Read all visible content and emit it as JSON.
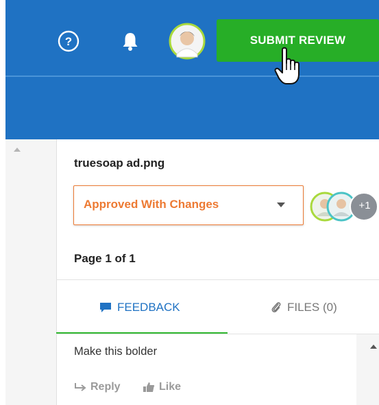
{
  "header": {
    "submit_label": "SUBMIT REVIEW",
    "help_icon": "help-circle-icon",
    "bell_icon": "bell-icon"
  },
  "file": {
    "name": "truesoap ad.png",
    "status": "Approved With Changes",
    "extra_reviewers": "+1",
    "page_label": "Page 1 of 1"
  },
  "tabs": [
    {
      "label": "FEEDBACK",
      "icon": "comment-icon"
    },
    {
      "label": "FILES (0)",
      "icon": "paperclip-icon"
    }
  ],
  "comments": [
    {
      "text": "Make this bolder",
      "reply_label": "Reply",
      "like_label": "Like"
    }
  ],
  "colors": {
    "header_bg": "#1f72c3",
    "submit_bg": "#27ae27",
    "status_accent": "#ed7a33",
    "active_tab_underline": "#2fb62f"
  }
}
